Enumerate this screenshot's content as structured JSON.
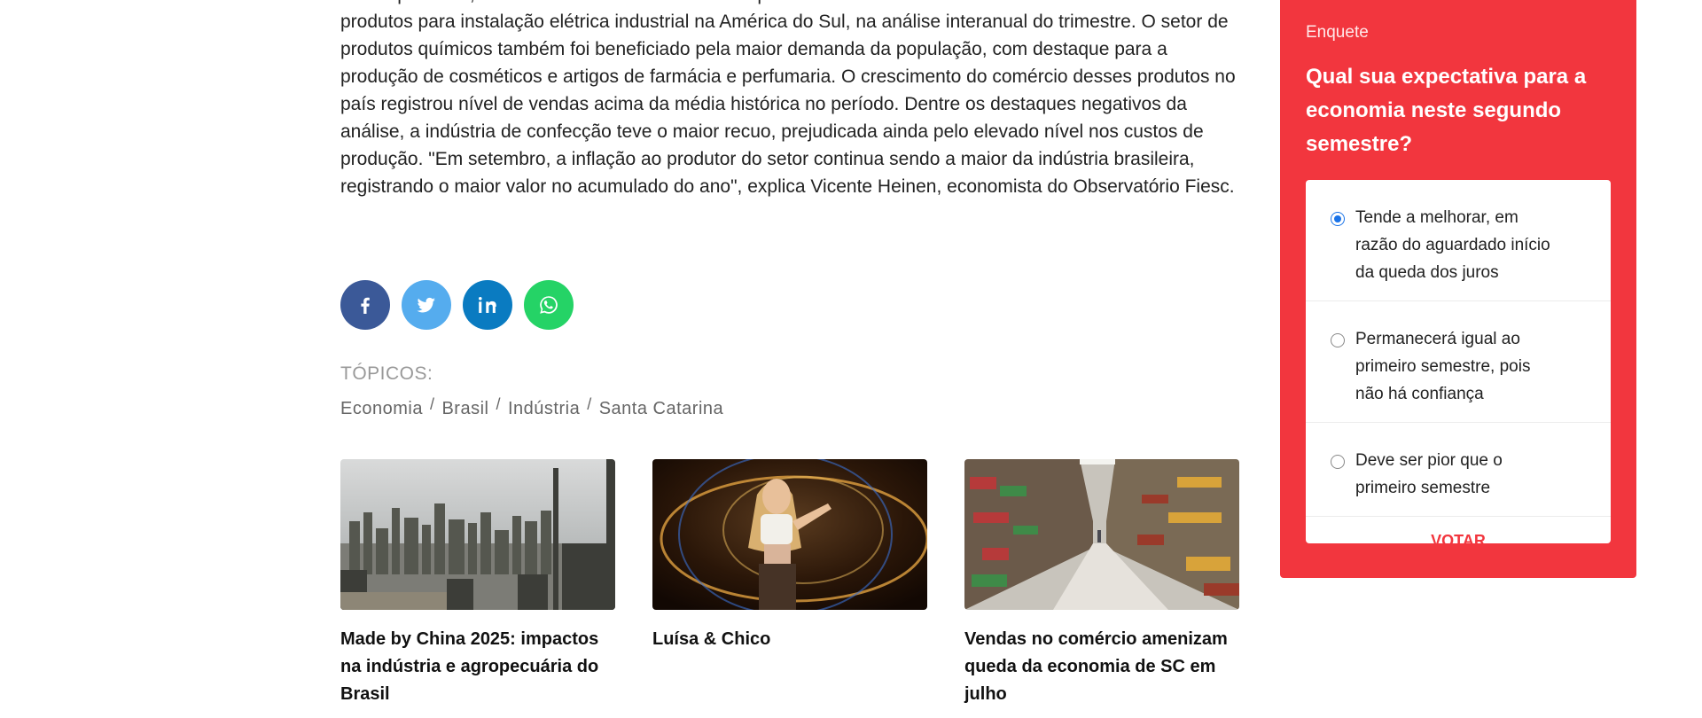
{
  "article": {
    "paragraph": "outros produtos, como os conversores eletrônicos para as indústrias dos Estados Unidos e Canadá e de produtos para instalação elétrica industrial na América do Sul, na análise interanual do trimestre. O setor de produtos químicos também foi beneficiado pela maior demanda da população, com destaque para a produção de cosméticos e artigos de farmácia e perfumaria. O crescimento do comércio desses produtos no país registrou nível de vendas acima da média histórica no período. Dentre os destaques negativos da análise, a indústria de confecção teve o maior recuo, prejudicada ainda pelo elevado nível nos custos de produção. \"Em setembro, a inflação ao produtor do setor continua sendo a maior da indústria brasileira, registrando o maior valor no acumulado do ano\", explica Vicente Heinen, economista do Observatório Fiesc."
  },
  "share": [
    {
      "icon": "facebook-icon",
      "color": "#3b5998"
    },
    {
      "icon": "twitter-icon",
      "color": "#55acee"
    },
    {
      "icon": "linkedin-icon",
      "color": "#0a7bc1"
    },
    {
      "icon": "whatsapp-icon",
      "color": "#25d366"
    }
  ],
  "topics": {
    "label": "TÓPICOS:",
    "separator": "/",
    "tags": [
      "Economia",
      "Brasil",
      "Indústria",
      "Santa Catarina"
    ]
  },
  "related": [
    {
      "title": "Made by China 2025: impactos na indústria e agropecuária do Brasil"
    },
    {
      "title": "Luísa & Chico"
    },
    {
      "title": "Vendas no comércio amenizam queda da economia de SC em julho"
    }
  ],
  "poll": {
    "label": "Enquete",
    "question": "Qual sua expectativa para a economia neste segundo semestre?",
    "options": [
      {
        "text": "Tende a melhorar, em razão do aguardado início da queda dos juros",
        "selected": true
      },
      {
        "text": "Permanecerá igual ao primeiro semestre, pois não há confiança",
        "selected": false
      },
      {
        "text": "Deve ser pior que o primeiro semestre",
        "selected": false
      }
    ],
    "vote_label": "VOTAR",
    "accent": "#f2363e"
  }
}
